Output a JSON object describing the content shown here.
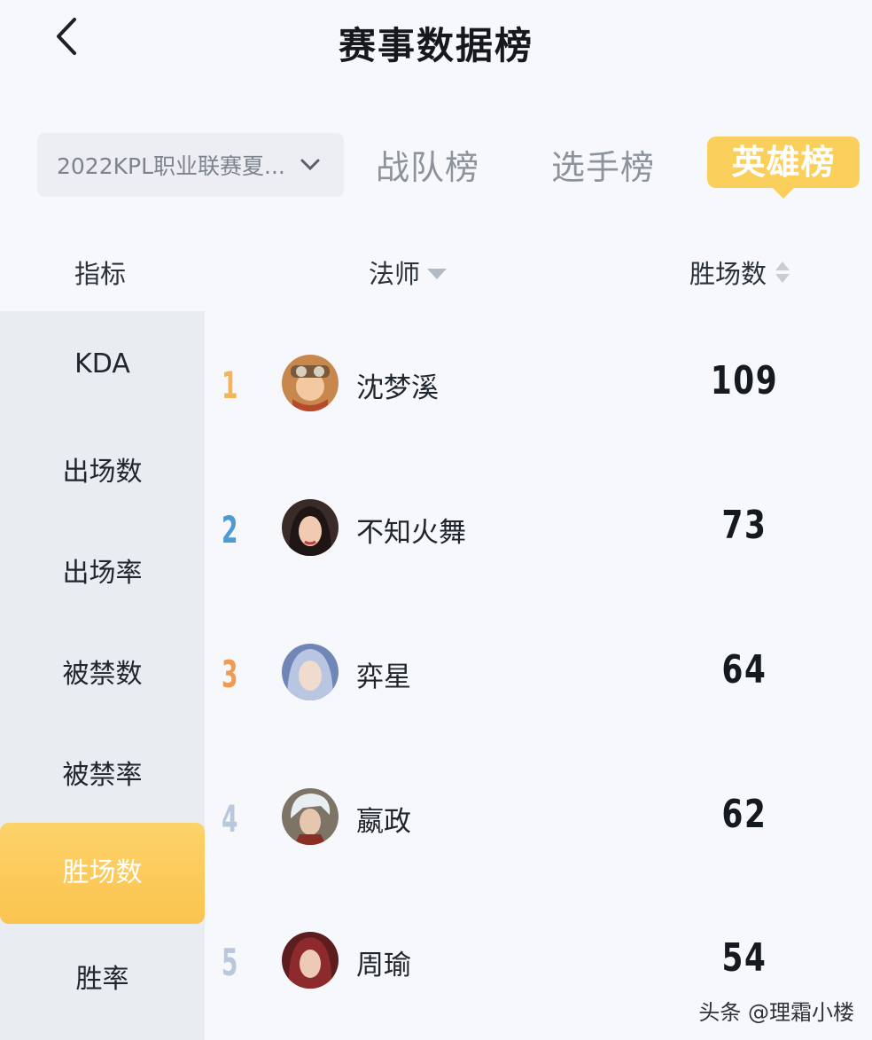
{
  "header": {
    "title": "赛事数据榜"
  },
  "filters": {
    "season": "2022KPL职业联赛夏...",
    "tabs": [
      {
        "label": "战队榜",
        "active": false
      },
      {
        "label": "选手榜",
        "active": false
      },
      {
        "label": "英雄榜",
        "active": true
      }
    ]
  },
  "columns": {
    "metric": "指标",
    "role": "法师",
    "value": "胜场数"
  },
  "metrics": [
    {
      "label": "KDA",
      "active": false
    },
    {
      "label": "出场数",
      "active": false
    },
    {
      "label": "出场率",
      "active": false
    },
    {
      "label": "被禁数",
      "active": false
    },
    {
      "label": "被禁率",
      "active": false
    },
    {
      "label": "胜场数",
      "active": true
    },
    {
      "label": "胜率",
      "active": false
    }
  ],
  "rows": [
    {
      "rank": "1",
      "name": "沈梦溪",
      "value": "109",
      "rank_color": "#f3b45c",
      "avatar_icon": "hero-shenmengxi-avatar"
    },
    {
      "rank": "2",
      "name": "不知火舞",
      "value": "73",
      "rank_color": "#4d9bd4",
      "avatar_icon": "hero-buzhihuowu-avatar"
    },
    {
      "rank": "3",
      "name": "弈星",
      "value": "64",
      "rank_color": "#f09a52",
      "avatar_icon": "hero-yixing-avatar"
    },
    {
      "rank": "4",
      "name": "嬴政",
      "value": "62",
      "rank_color": "#b9c8dc",
      "avatar_icon": "hero-yingzheng-avatar"
    },
    {
      "rank": "5",
      "name": "周瑜",
      "value": "54",
      "rank_color": "#b9c8dc",
      "avatar_icon": "hero-zhouyu-avatar"
    }
  ],
  "watermark": "头条 @理霜小楼",
  "colors": {
    "accent": "#fbcf5c",
    "sidebar": "#e9ecf1",
    "background": "#f7f8fb"
  }
}
